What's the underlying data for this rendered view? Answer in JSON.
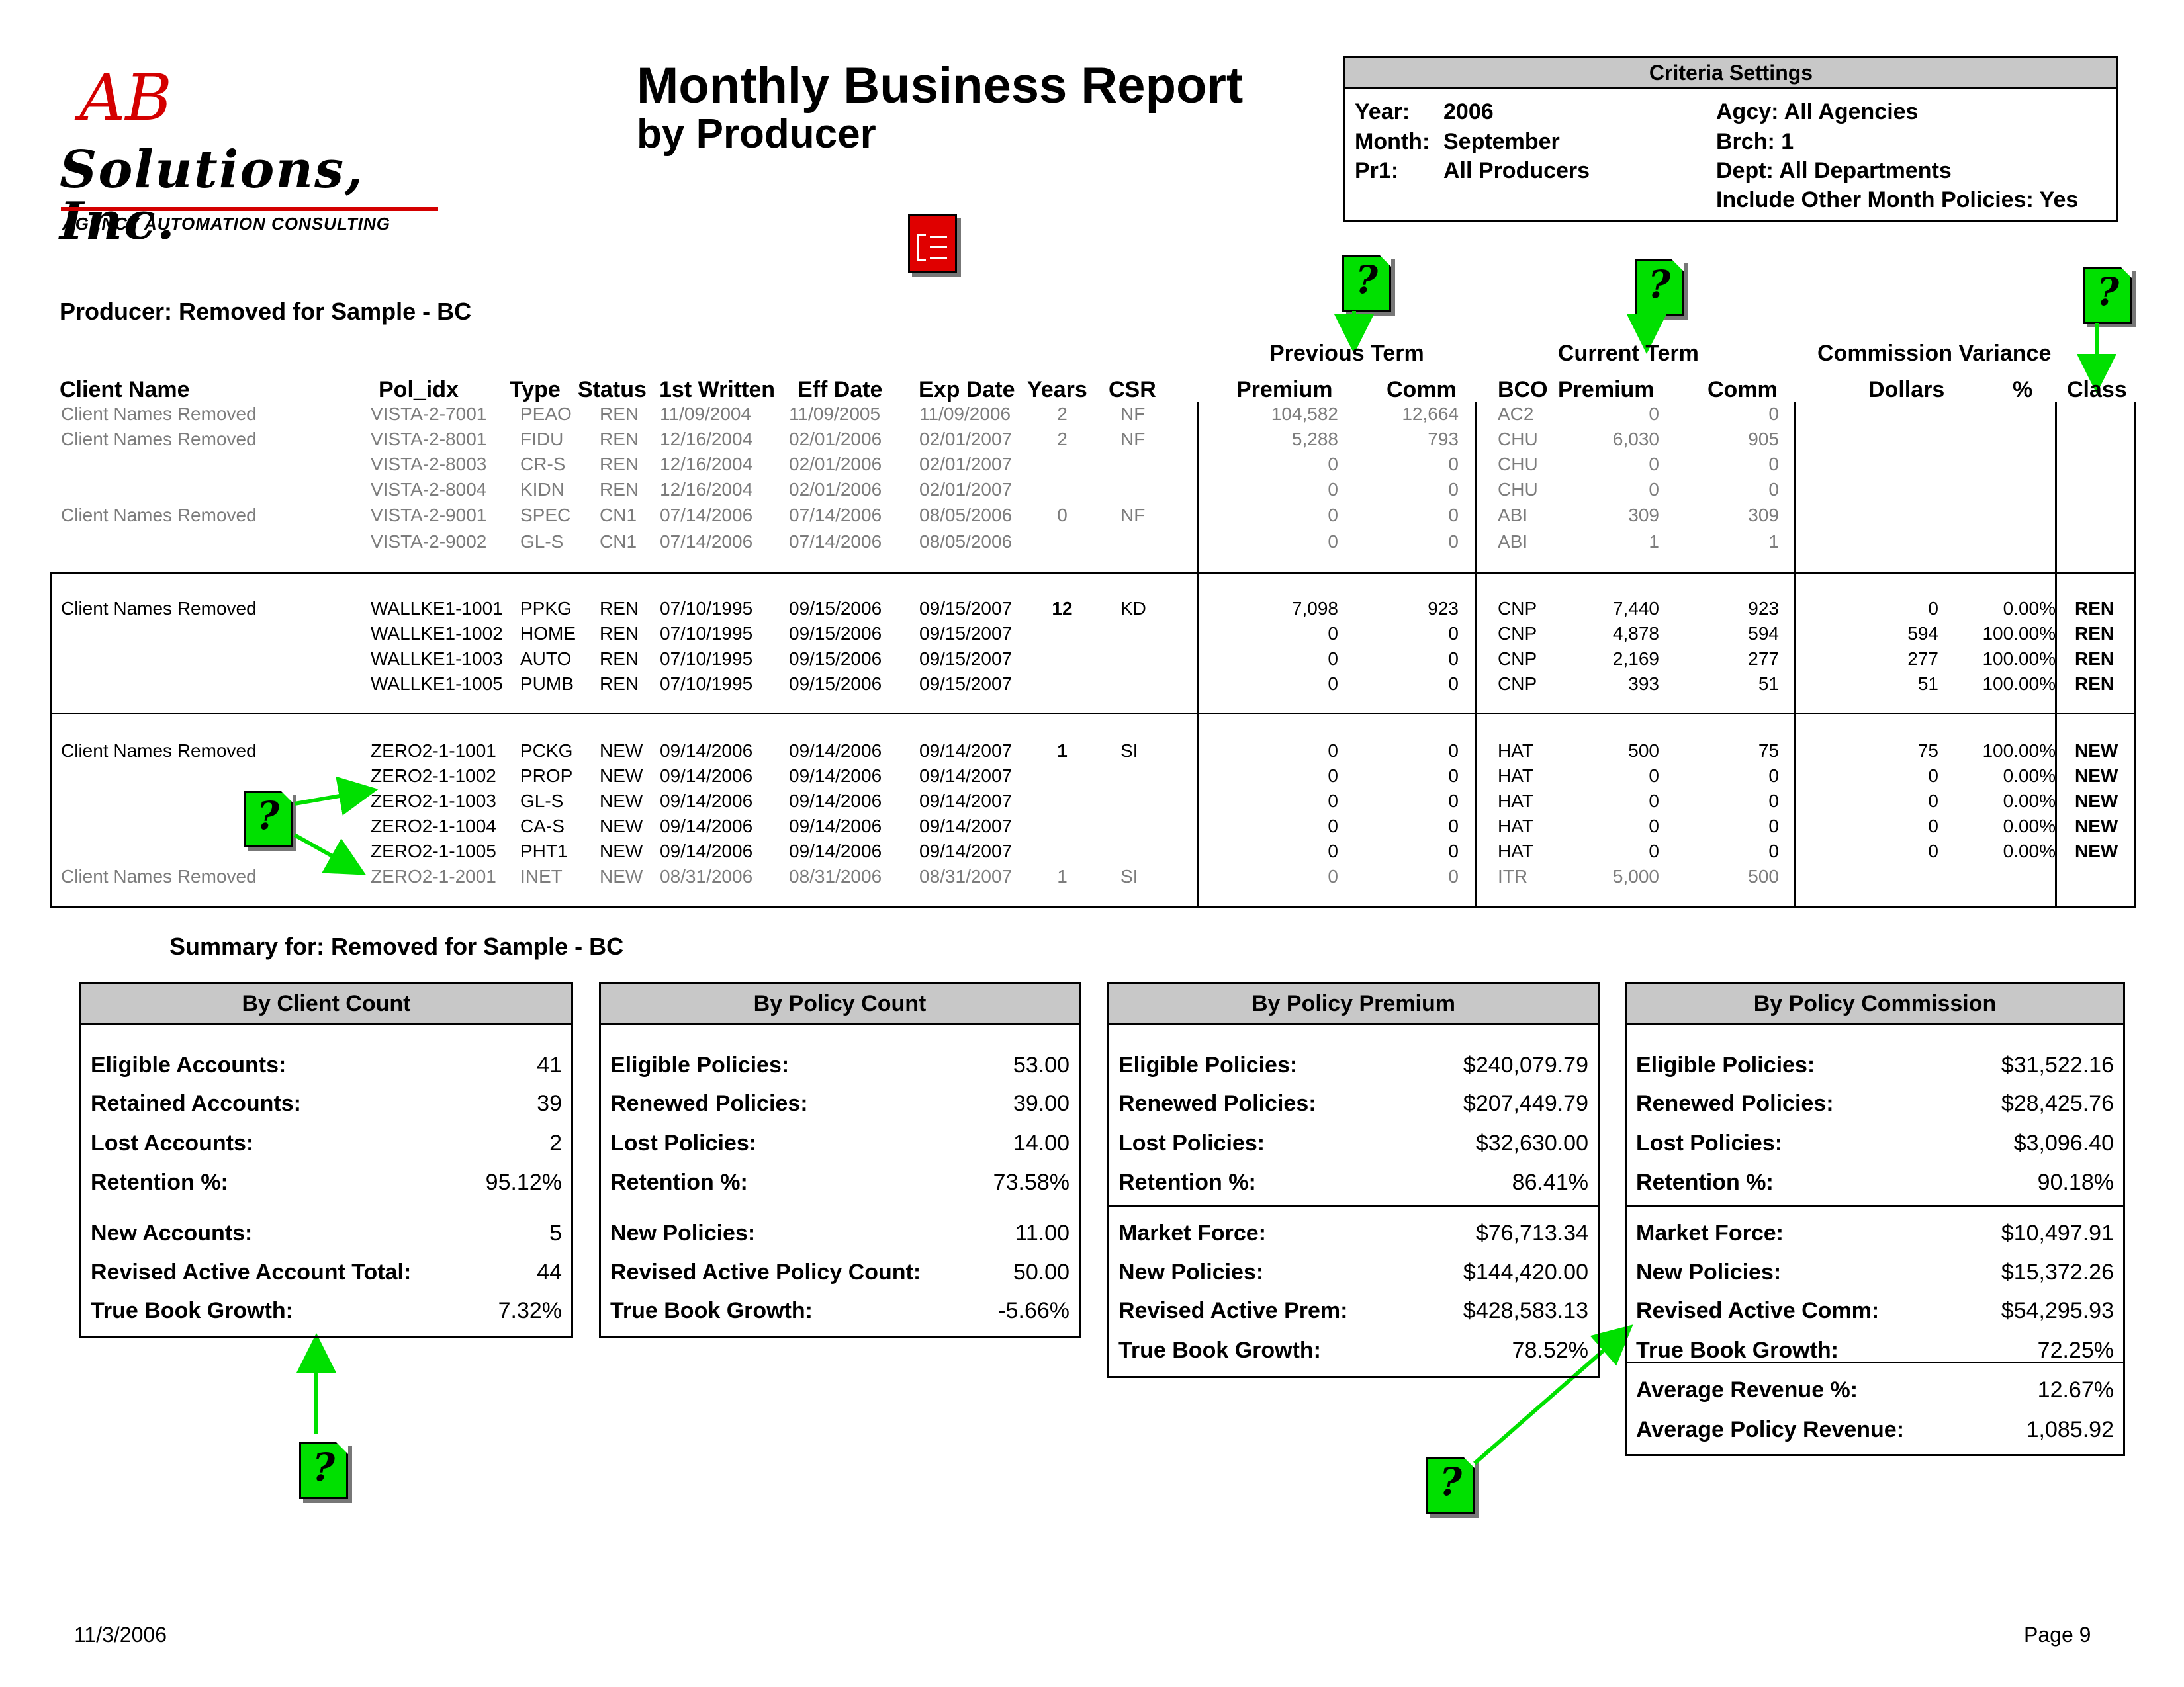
{
  "logo": {
    "ab": "AB",
    "company": "Solutions, Inc.",
    "tagline": "AGENCY AUTOMATION CONSULTING"
  },
  "title": "Monthly Business Report",
  "subtitle": "by Producer",
  "criteria": {
    "header": "Criteria Settings",
    "year_label": "Year:",
    "year": "2006",
    "month_label": "Month:",
    "month": "September",
    "pr1_label": "Pr1:",
    "pr1": "All Producers",
    "agcy_label": "Agcy:",
    "agcy": "All Agencies",
    "brch_label": "Brch:",
    "brch": "1",
    "dept_label": "Dept:",
    "dept": "All Departments",
    "include_label": "Include Other Month Policies:",
    "include": "Yes"
  },
  "producer_line": "Producer: Removed for Sample -  BC",
  "groups": {
    "previous_term": "Previous Term",
    "current_term": "Current Term",
    "commission_variance": "Commission Variance"
  },
  "columns": {
    "client_name": "Client Name",
    "pol_idx": "Pol_idx",
    "type": "Type",
    "status": "Status",
    "first_written": "1st Written",
    "eff_date": "Eff Date",
    "exp_date": "Exp Date",
    "years": "Years",
    "csr": "CSR",
    "prev_premium": "Premium",
    "prev_comm": "Comm",
    "bco": "BCO",
    "cur_premium": "Premium",
    "cur_comm": "Comm",
    "dollars": "Dollars",
    "pct": "%",
    "class": "Class"
  },
  "rows": [
    [
      "Client Names Removed",
      "VISTA-2-7001",
      "PEAO",
      "REN",
      "11/09/2004",
      "11/09/2005",
      "11/09/2006",
      "2",
      "NF",
      "104,582",
      "12,664",
      "AC2",
      "0",
      "0",
      "",
      "",
      ""
    ],
    [
      "Client Names Removed",
      "VISTA-2-8001",
      "FIDU",
      "REN",
      "12/16/2004",
      "02/01/2006",
      "02/01/2007",
      "2",
      "NF",
      "5,288",
      "793",
      "CHU",
      "6,030",
      "905",
      "",
      "",
      ""
    ],
    [
      "",
      "VISTA-2-8003",
      "CR-S",
      "REN",
      "12/16/2004",
      "02/01/2006",
      "02/01/2007",
      "",
      "",
      "0",
      "0",
      "CHU",
      "0",
      "0",
      "",
      "",
      ""
    ],
    [
      "",
      "VISTA-2-8004",
      "KIDN",
      "REN",
      "12/16/2004",
      "02/01/2006",
      "02/01/2007",
      "",
      "",
      "0",
      "0",
      "CHU",
      "0",
      "0",
      "",
      "",
      ""
    ],
    [
      "Client Names Removed",
      "VISTA-2-9001",
      "SPEC",
      "CN1",
      "07/14/2006",
      "07/14/2006",
      "08/05/2006",
      "0",
      "NF",
      "0",
      "0",
      "ABI",
      "309",
      "309",
      "",
      "",
      ""
    ],
    [
      "",
      "VISTA-2-9002",
      "GL-S",
      "CN1",
      "07/14/2006",
      "07/14/2006",
      "08/05/2006",
      "",
      "",
      "0",
      "0",
      "ABI",
      "1",
      "1",
      "",
      "",
      ""
    ],
    [
      "Client Names Removed",
      "WALLKE1-1001",
      "PPKG",
      "REN",
      "07/10/1995",
      "09/15/2006",
      "09/15/2007",
      "12",
      "KD",
      "7,098",
      "923",
      "CNP",
      "7,440",
      "923",
      "0",
      "0.00%",
      "REN"
    ],
    [
      "",
      "WALLKE1-1002",
      "HOME",
      "REN",
      "07/10/1995",
      "09/15/2006",
      "09/15/2007",
      "",
      "",
      "0",
      "0",
      "CNP",
      "4,878",
      "594",
      "594",
      "100.00%",
      "REN"
    ],
    [
      "",
      "WALLKE1-1003",
      "AUTO",
      "REN",
      "07/10/1995",
      "09/15/2006",
      "09/15/2007",
      "",
      "",
      "0",
      "0",
      "CNP",
      "2,169",
      "277",
      "277",
      "100.00%",
      "REN"
    ],
    [
      "",
      "WALLKE1-1005",
      "PUMB",
      "REN",
      "07/10/1995",
      "09/15/2006",
      "09/15/2007",
      "",
      "",
      "0",
      "0",
      "CNP",
      "393",
      "51",
      "51",
      "100.00%",
      "REN"
    ],
    [
      "Client Names Removed",
      "ZERO2-1-1001",
      "PCKG",
      "NEW",
      "09/14/2006",
      "09/14/2006",
      "09/14/2007",
      "1",
      "SI",
      "0",
      "0",
      "HAT",
      "500",
      "75",
      "75",
      "100.00%",
      "NEW"
    ],
    [
      "",
      "ZERO2-1-1002",
      "PROP",
      "NEW",
      "09/14/2006",
      "09/14/2006",
      "09/14/2007",
      "",
      "",
      "0",
      "0",
      "HAT",
      "0",
      "0",
      "0",
      "0.00%",
      "NEW"
    ],
    [
      "",
      "ZERO2-1-1003",
      "GL-S",
      "NEW",
      "09/14/2006",
      "09/14/2006",
      "09/14/2007",
      "",
      "",
      "0",
      "0",
      "HAT",
      "0",
      "0",
      "0",
      "0.00%",
      "NEW"
    ],
    [
      "",
      "ZERO2-1-1004",
      "CA-S",
      "NEW",
      "09/14/2006",
      "09/14/2006",
      "09/14/2007",
      "",
      "",
      "0",
      "0",
      "HAT",
      "0",
      "0",
      "0",
      "0.00%",
      "NEW"
    ],
    [
      "",
      "ZERO2-1-1005",
      "PHT1",
      "NEW",
      "09/14/2006",
      "09/14/2006",
      "09/14/2007",
      "",
      "",
      "0",
      "0",
      "HAT",
      "0",
      "0",
      "0",
      "0.00%",
      "NEW"
    ],
    [
      "Client Names Removed",
      "ZERO2-1-2001",
      "INET",
      "NEW",
      "08/31/2006",
      "08/31/2006",
      "08/31/2007",
      "1",
      "SI",
      "0",
      "0",
      "ITR",
      "5,000",
      "500",
      "",
      "",
      ""
    ]
  ],
  "summary_title": "Summary for: Removed for Sample -  BC",
  "summary": [
    {
      "title": "By Client Count",
      "rows": [
        [
          "Eligible Accounts:",
          "41"
        ],
        [
          "Retained Accounts:",
          "39"
        ],
        [
          "Lost Accounts:",
          "2"
        ],
        [
          "Retention %:",
          "95.12%"
        ],
        [
          "New Accounts:",
          "5"
        ],
        [
          "Revised Active Account Total:",
          "44"
        ],
        [
          "True Book Growth:",
          "7.32%"
        ]
      ]
    },
    {
      "title": "By Policy Count",
      "rows": [
        [
          "Eligible Policies:",
          "53.00"
        ],
        [
          "Renewed Policies:",
          "39.00"
        ],
        [
          "Lost Policies:",
          "14.00"
        ],
        [
          "Retention %:",
          "73.58%"
        ],
        [
          "New Policies:",
          "11.00"
        ],
        [
          "Revised Active Policy Count:",
          "50.00"
        ],
        [
          "True Book Growth:",
          "-5.66%"
        ]
      ]
    },
    {
      "title": "By Policy Premium",
      "rows": [
        [
          "Eligible Policies:",
          "$240,079.79"
        ],
        [
          "Renewed Policies:",
          "$207,449.79"
        ],
        [
          "Lost Policies:",
          "$32,630.00"
        ],
        [
          "Retention %:",
          "86.41%"
        ],
        [
          "Market Force:",
          "$76,713.34"
        ],
        [
          "New Policies:",
          "$144,420.00"
        ],
        [
          "Revised Active Prem:",
          "$428,583.13"
        ],
        [
          "True Book Growth:",
          "78.52%"
        ]
      ]
    },
    {
      "title": "By Policy Commission",
      "rows": [
        [
          "Eligible Policies:",
          "$31,522.16"
        ],
        [
          "Renewed Policies:",
          "$28,425.76"
        ],
        [
          "Lost Policies:",
          "$3,096.40"
        ],
        [
          "Retention %:",
          "90.18%"
        ],
        [
          "Market Force:",
          "$10,497.91"
        ],
        [
          "New Policies:",
          "$15,372.26"
        ],
        [
          "Revised Active Comm:",
          "$54,295.93"
        ],
        [
          "True Book Growth:",
          "72.25%"
        ],
        [
          "Average Revenue %:",
          "12.67%"
        ],
        [
          "Average Policy Revenue:",
          "1,085.92"
        ]
      ]
    }
  ],
  "footer": {
    "date": "11/3/2006",
    "page": "Page 9"
  },
  "colors": {
    "logo_red": "#d40000",
    "help_icon": "#00e000",
    "report_icon": "#e00000",
    "header_gray": "#c8c8c8",
    "dim_text": "#7c7c7c",
    "arrow": "#00e000"
  },
  "icons": [
    "help-note-icon",
    "report-icon"
  ]
}
